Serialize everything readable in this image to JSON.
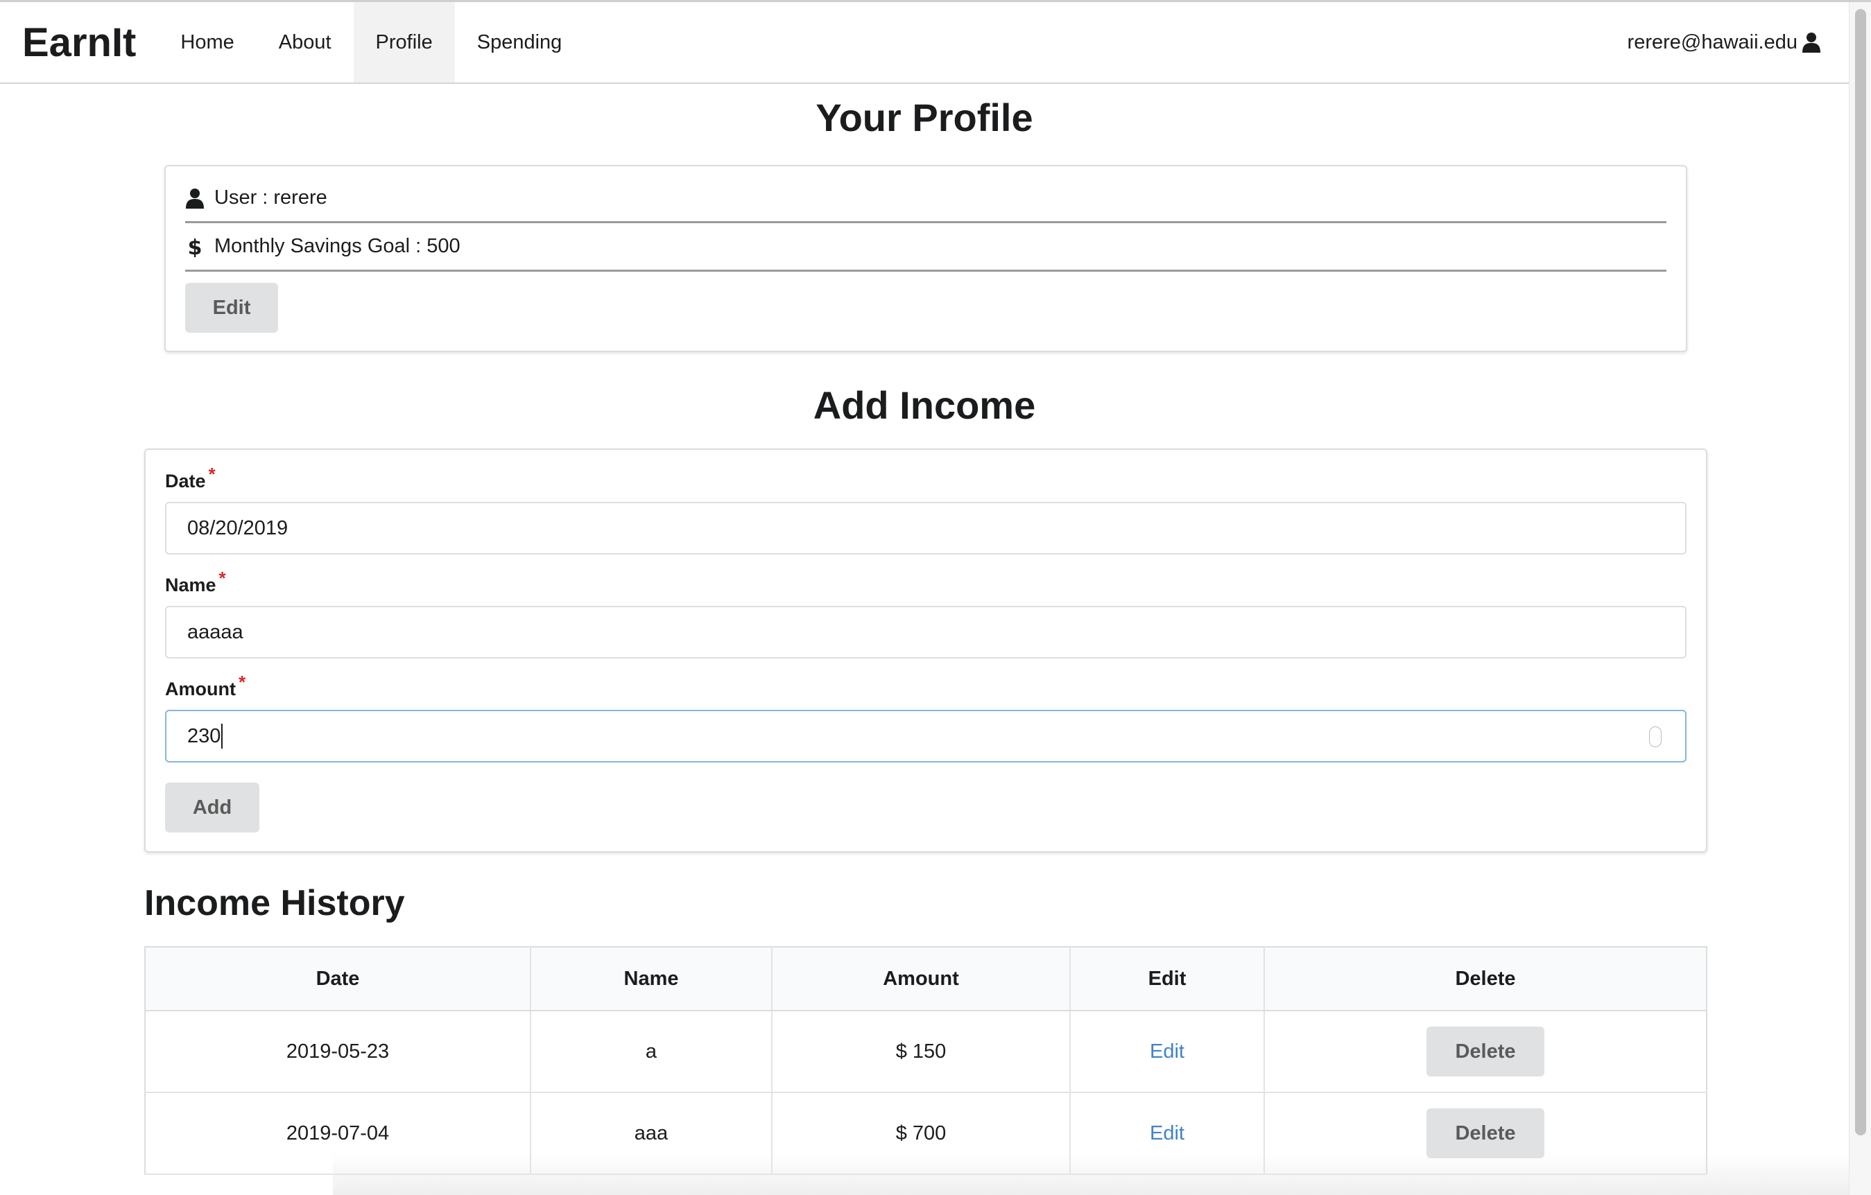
{
  "nav": {
    "brand": "EarnIt",
    "items": [
      {
        "label": "Home"
      },
      {
        "label": "About"
      },
      {
        "label": "Profile"
      },
      {
        "label": "Spending"
      }
    ],
    "active": "Profile",
    "user_email": "rerere@hawaii.edu"
  },
  "profile": {
    "heading": "Your Profile",
    "user_line": "User : rerere",
    "savings_line": "Monthly Savings Goal : 500",
    "edit_label": "Edit"
  },
  "add_income": {
    "heading": "Add Income",
    "date_label": "Date",
    "date_value": "08/20/2019",
    "name_label": "Name",
    "name_value": "aaaaa",
    "amount_label": "Amount",
    "amount_value": "230",
    "required_mark": "*",
    "add_label": "Add"
  },
  "history": {
    "heading": "Income History",
    "columns": [
      "Date",
      "Name",
      "Amount",
      "Edit",
      "Delete"
    ],
    "rows": [
      {
        "date": "2019-05-23",
        "name": "a",
        "amount": "$ 150",
        "edit": "Edit",
        "delete": "Delete"
      },
      {
        "date": "2019-07-04",
        "name": "aaa",
        "amount": "$ 700",
        "edit": "Edit",
        "delete": "Delete"
      }
    ]
  },
  "colors": {
    "link": "#4183c4",
    "required": "#db2828",
    "focus_border": "#85b7d9",
    "button_bg": "#e0e1e2"
  },
  "icons": {
    "user": "user-icon",
    "dollar": "dollar-icon"
  }
}
